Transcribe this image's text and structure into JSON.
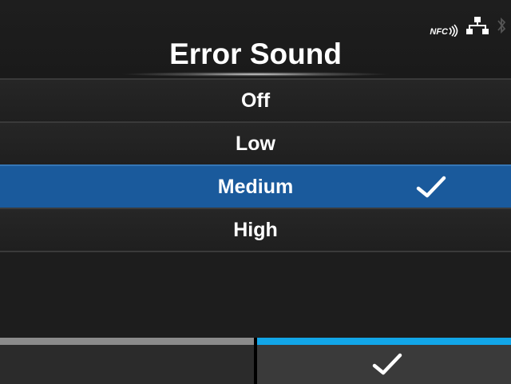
{
  "header": {
    "title": "Error Sound",
    "status": {
      "nfc_label": "NFC",
      "icons": [
        "nfc-icon",
        "network-icon",
        "bluetooth-icon"
      ]
    }
  },
  "options": [
    {
      "label": "Off",
      "selected": false
    },
    {
      "label": "Low",
      "selected": false
    },
    {
      "label": "Medium",
      "selected": true
    },
    {
      "label": "High",
      "selected": false
    }
  ],
  "footer": {
    "left_button": {
      "label": ""
    },
    "right_button": {
      "icon": "checkmark-icon"
    }
  },
  "colors": {
    "background": "#1d1d1d",
    "selected_row": "#1a5a9c",
    "accent_bar": "#12a6e8",
    "inactive_bar": "#8b8b8b",
    "text": "#ffffff"
  }
}
